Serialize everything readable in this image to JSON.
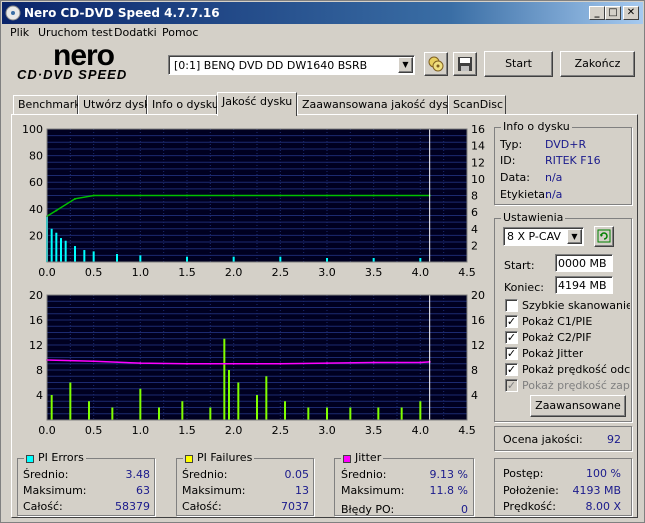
{
  "window": {
    "title": "Nero CD-DVD Speed 4.7.7.16"
  },
  "menu": [
    "Plik",
    "Uruchom test",
    "Dodatki",
    "Pomoc"
  ],
  "logo": {
    "top": "nero",
    "bottom": "CD·DVD SPEED"
  },
  "drive_select": {
    "value": "[0:1]   BENQ DVD DD DW1640 BSRB"
  },
  "buttons": {
    "start": "Start",
    "end": "Zakończ",
    "advanced": "Zaawansowane"
  },
  "tabs": [
    "Benchmark",
    "Utwórz dysk",
    "Info o dysku",
    "Jakość dysku",
    "Zaawansowana jakość dysku",
    "ScanDisc"
  ],
  "active_tab": 3,
  "disc_info": {
    "title": "Info o dysku",
    "type_label": "Typ:",
    "type_value": "DVD+R",
    "id_label": "ID:",
    "id_value": "RITEK F16",
    "date_label": "Data:",
    "date_value": "n/a",
    "tag_label": "Etykieta:",
    "tag_value": "n/a"
  },
  "settings": {
    "title": "Ustawienia",
    "speed": "8 X P-CAV",
    "start_label": "Start:",
    "start_value": "0000 MB",
    "end_label": "Koniec:",
    "end_value": "4194 MB",
    "checkboxes": [
      {
        "label": "Szybkie skanowanie",
        "checked": false,
        "disabled": false
      },
      {
        "label": "Pokaż C1/PIE",
        "checked": true,
        "disabled": false
      },
      {
        "label": "Pokaż C2/PIF",
        "checked": true,
        "disabled": false
      },
      {
        "label": "Pokaż Jitter",
        "checked": true,
        "disabled": false
      },
      {
        "label": "Pokaż prędkość odczyt",
        "checked": true,
        "disabled": false
      },
      {
        "label": "Pokaż prędkość zapisu",
        "checked": true,
        "disabled": true
      }
    ]
  },
  "quality": {
    "label": "Ocena jakości:",
    "value": "92"
  },
  "pi_errors": {
    "title": "PI Errors",
    "color": "#00ffff",
    "avg_label": "Średnio:",
    "avg": "3.48",
    "max_label": "Maksimum:",
    "max": "63",
    "total_label": "Całość:",
    "total": "58379"
  },
  "pi_failures": {
    "title": "PI Failures",
    "color": "#ffff00",
    "avg_label": "Średnio:",
    "avg": "0.05",
    "max_label": "Maksimum:",
    "max": "13",
    "total_label": "Całość:",
    "total": "7037"
  },
  "jitter": {
    "title": "Jitter",
    "color": "#ff00ff",
    "avg_label": "Średnio:",
    "avg": "9.13 %",
    "max_label": "Maksimum:",
    "max": "11.8 %",
    "po_label": "Błędy PO:",
    "po": "0"
  },
  "progress": {
    "progress_label": "Postęp:",
    "progress_value": "100 %",
    "position_label": "Położenie:",
    "position_value": "4193 MB",
    "speed_label": "Prędkość:",
    "speed_value": "8.00 X"
  },
  "chart_data": [
    {
      "type": "line",
      "name": "PI Errors / read speed",
      "x_ticks": [
        "0.0",
        "0.5",
        "1.0",
        "1.5",
        "2.0",
        "2.5",
        "3.0",
        "3.5",
        "4.0",
        "4.5"
      ],
      "y_left_ticks": [
        "100",
        "80",
        "60",
        "40",
        "20"
      ],
      "y_right_ticks": [
        "16",
        "14",
        "12",
        "10",
        "8",
        "6",
        "4",
        "2"
      ],
      "xlim": [
        0,
        4.5
      ],
      "ylim_left": [
        0,
        100
      ],
      "ylim_right": [
        0,
        16
      ],
      "end_marker_x": 4.1,
      "series": [
        {
          "color": "#00ffff",
          "kind": "bars",
          "x": [
            0.0,
            0.05,
            0.1,
            0.15,
            0.2,
            0.3,
            0.4,
            0.5,
            0.75,
            1.0,
            1.5,
            2.0,
            2.5,
            3.0,
            3.5,
            4.0
          ],
          "values": [
            35,
            25,
            22,
            18,
            16,
            12,
            9,
            8,
            6,
            5,
            4,
            4,
            4,
            3,
            3,
            3
          ]
        },
        {
          "color": "#00c000",
          "kind": "line",
          "axis": "right",
          "x": [
            0.0,
            0.1,
            0.3,
            0.5,
            1.0,
            1.5,
            2.0,
            2.5,
            3.0,
            3.5,
            4.1
          ],
          "values": [
            5.5,
            6.2,
            7.6,
            8.0,
            8.0,
            8.0,
            8.0,
            8.0,
            8.0,
            8.0,
            8.0
          ]
        }
      ]
    },
    {
      "type": "line",
      "name": "PI Failures / jitter",
      "x_ticks": [
        "0.0",
        "0.5",
        "1.0",
        "1.5",
        "2.0",
        "2.5",
        "3.0",
        "3.5",
        "4.0",
        "4.5"
      ],
      "y_left_ticks": [
        "20",
        "16",
        "12",
        "8",
        "4"
      ],
      "y_right_ticks": [
        "20",
        "16",
        "12",
        "8",
        "4"
      ],
      "xlim": [
        0,
        4.5
      ],
      "ylim_left": [
        0,
        20
      ],
      "ylim_right": [
        0,
        20
      ],
      "end_marker_x": 4.1,
      "series": [
        {
          "color": "#80ff00",
          "kind": "bars",
          "x": [
            0.05,
            0.25,
            0.45,
            0.7,
            1.0,
            1.2,
            1.45,
            1.75,
            1.9,
            1.95,
            2.05,
            2.25,
            2.35,
            2.55,
            2.8,
            3.0,
            3.25,
            3.55,
            3.8,
            4.0
          ],
          "values": [
            4,
            6,
            3,
            2,
            5,
            2,
            3,
            2,
            13,
            8,
            6,
            4,
            7,
            3,
            2,
            2,
            2,
            2,
            2,
            3
          ]
        },
        {
          "color": "#ff00ff",
          "kind": "line",
          "x": [
            0.0,
            0.5,
            1.0,
            1.5,
            2.0,
            2.5,
            3.0,
            3.5,
            4.0,
            4.1
          ],
          "values": [
            9.6,
            9.4,
            9.1,
            9.0,
            9.0,
            9.0,
            9.1,
            9.2,
            9.2,
            9.3
          ]
        }
      ]
    }
  ]
}
